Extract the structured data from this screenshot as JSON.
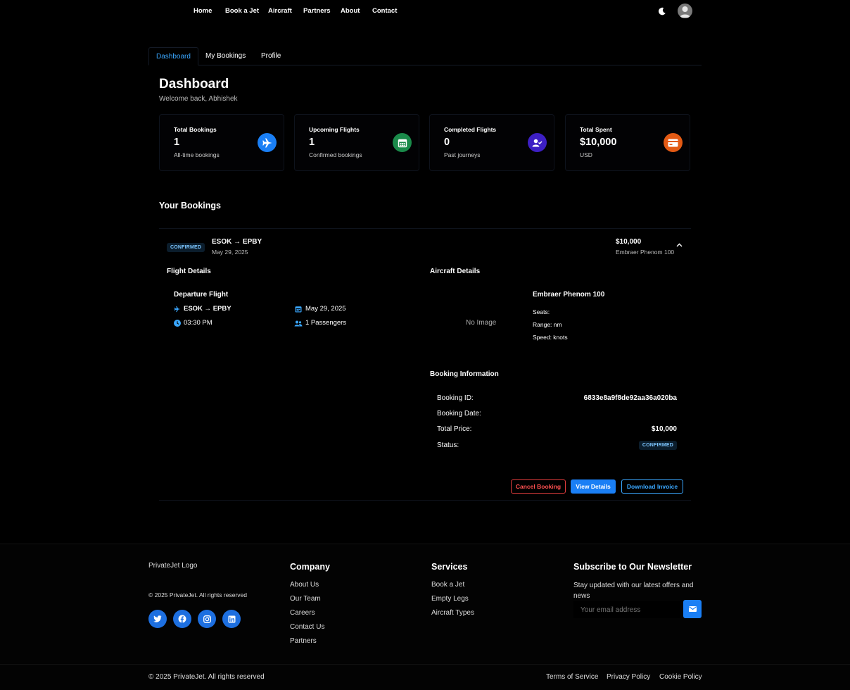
{
  "nav": {
    "items": [
      "Home",
      "Book a Jet",
      "Aircraft",
      "Partners",
      "About",
      "Contact"
    ]
  },
  "tabs": [
    "Dashboard",
    "My Bookings",
    "Profile"
  ],
  "dashboard": {
    "title": "Dashboard",
    "welcome": "Welcome back, Abhishek"
  },
  "stats": [
    {
      "label": "Total Bookings",
      "value": "1",
      "sub": "All-time bookings",
      "icon": "plane-icon",
      "color": "#1a7ff5"
    },
    {
      "label": "Upcoming Flights",
      "value": "1",
      "sub": "Confirmed bookings",
      "icon": "calendar-icon",
      "color": "#1a8a4a"
    },
    {
      "label": "Completed Flights",
      "value": "0",
      "sub": "Past journeys",
      "icon": "user-check-icon",
      "color": "#3d1fc4"
    },
    {
      "label": "Total Spent",
      "value": "$10,000",
      "sub": "USD",
      "icon": "credit-card-icon",
      "color": "#e35a14"
    }
  ],
  "bookings_title": "Your Bookings",
  "booking": {
    "status": "CONFIRMED",
    "route": "ESOK → EPBY",
    "date": "May 29, 2025",
    "price": "$10,000",
    "aircraft": "Embraer Phenom 100",
    "flight_details_title": "Flight Details",
    "departure_title": "Departure Flight",
    "departure_route": "ESOK → EPBY",
    "departure_date": "May 29, 2025",
    "departure_time": "03:30 PM",
    "passengers": "1 Passengers",
    "aircraft_details_title": "Aircraft Details",
    "no_image": "No Image",
    "aircraft_name": "Embraer Phenom 100",
    "seats": "Seats:",
    "range": "Range: nm",
    "speed": "Speed: knots",
    "info_title": "Booking Information",
    "info_rows": [
      {
        "label": "Booking ID:",
        "value": "6833e8a9f8de92aa36a020ba"
      },
      {
        "label": "Booking Date:",
        "value": ""
      },
      {
        "label": "Total Price:",
        "value": "$10,000"
      },
      {
        "label": "Status:",
        "value": "CONFIRMED"
      }
    ],
    "buttons": {
      "cancel": "Cancel Booking",
      "view": "View Details",
      "invoice": "Download Invoice"
    }
  },
  "footer": {
    "logo_alt": "PrivateJet Logo",
    "copyright_small": "© 2025 PrivateJet. All rights reserved",
    "company_title": "Company",
    "company_links": [
      "About Us",
      "Our Team",
      "Careers",
      "Contact Us",
      "Partners"
    ],
    "services_title": "Services",
    "services_links": [
      "Book a Jet",
      "Empty Legs",
      "Aircraft Types"
    ],
    "newsletter_title": "Subscribe to Our Newsletter",
    "newsletter_text": "Stay updated with our latest offers and news",
    "email_placeholder": "Your email address",
    "copyright": "© 2025 PrivateJet. All rights reserved",
    "legal_links": [
      "Terms of Service",
      "Privacy Policy",
      "Cookie Policy"
    ]
  },
  "colors": {
    "accent": "#1a7ff5",
    "danger": "#e03c3c",
    "link": "#3aa7ff"
  }
}
